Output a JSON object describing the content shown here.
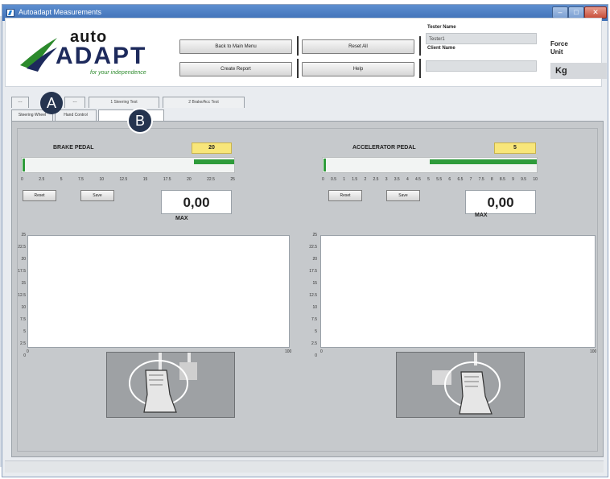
{
  "window": {
    "title": "Autoadapt Measurements"
  },
  "logo": {
    "top": "auto",
    "main": "ADAPT",
    "tagline": "for your independence"
  },
  "toolbar": {
    "back_label": "Back to Main Menu",
    "reset_label": "Reset All",
    "report_label": "Create Report",
    "help_label": "Help"
  },
  "fields": {
    "tester_label": "Tester Name",
    "tester_value": "Tester1",
    "client_label": "Client Name",
    "client_value": ""
  },
  "force": {
    "label_line1": "Force",
    "label_line2": "Unit",
    "unit": "Kg"
  },
  "tabs_top": [
    "---",
    "---",
    "1 Steering Test",
    "2 Brake/Acc Test"
  ],
  "tabs_bottom": [
    "Steering Wheel",
    "Hand Control",
    ""
  ],
  "badges": {
    "a": "A",
    "b": "B"
  },
  "brake": {
    "title": "BRAKE PEDAL",
    "value": "20",
    "level": 0.19,
    "scale": [
      "0",
      "2.5",
      "5",
      "7.5",
      "10",
      "12.5",
      "15",
      "17.5",
      "20",
      "22.5",
      "25"
    ],
    "reset_label": "Reset",
    "save_label": "Save",
    "readout": "0,00",
    "max_label": "MAX",
    "y_ticks": [
      "25",
      "22.5",
      "20",
      "17.5",
      "15",
      "12.5",
      "10",
      "7.5",
      "5",
      "2.5",
      "0"
    ],
    "x_start": "0",
    "x_end": "100"
  },
  "accel": {
    "title": "ACCELERATOR PEDAL",
    "value": "5",
    "level": 0.5,
    "scale": [
      "0",
      "0.5",
      "1",
      "1.5",
      "2",
      "2.5",
      "3",
      "3.5",
      "4",
      "4.5",
      "5",
      "5.5",
      "6",
      "6.5",
      "7",
      "7.5",
      "8",
      "8.5",
      "9",
      "9.5",
      "10"
    ],
    "reset_label": "Reset",
    "save_label": "Save",
    "readout": "0,00",
    "max_label": "MAX",
    "y_ticks": [
      "25",
      "22.5",
      "20",
      "17.5",
      "15",
      "12.5",
      "10",
      "7.5",
      "5",
      "2.5",
      "0"
    ],
    "x_start": "0",
    "x_end": "100"
  },
  "colors": {
    "accent_green": "#2e9b3a",
    "value_yellow": "#f8e67a",
    "badge_navy": "#25344f"
  }
}
